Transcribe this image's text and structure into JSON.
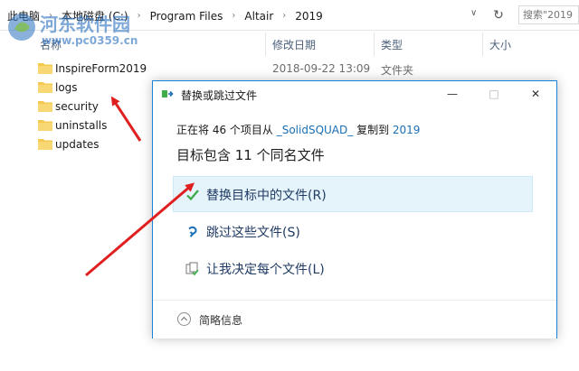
{
  "explorer": {
    "breadcrumbs": [
      "此电脑",
      "本地磁盘 (C:)",
      "Program Files",
      "Altair",
      "2019"
    ],
    "search_placeholder": "搜索\"2019",
    "columns": {
      "name": "名称",
      "modified": "修改日期",
      "type": "类型",
      "size": "大小"
    },
    "items": [
      {
        "name": "InspireForm2019",
        "modified": "2018-09-22 13:09",
        "type": "文件夹"
      },
      {
        "name": "logs",
        "modified": "",
        "type": ""
      },
      {
        "name": "security",
        "modified": "",
        "type": ""
      },
      {
        "name": "uninstalls",
        "modified": "",
        "type": ""
      },
      {
        "name": "updates",
        "modified": "",
        "type": ""
      }
    ]
  },
  "watermark": {
    "title": "河东软件园",
    "url": "www.pc0359.cn"
  },
  "dialog": {
    "title": "替换或跳过文件",
    "summary_prefix": "正在将 46 个项目从 ",
    "summary_source": "_SolidSQUAD_",
    "summary_middle": " 复制到 ",
    "summary_dest": "2019",
    "heading": "目标包含 11 个同名文件",
    "options": [
      {
        "label": "替换目标中的文件(R)",
        "icon": "check-icon",
        "selected": true
      },
      {
        "label": "跳过这些文件(S)",
        "icon": "skip-icon",
        "selected": false
      },
      {
        "label": "让我决定每个文件(L)",
        "icon": "decide-icon",
        "selected": false
      }
    ],
    "details_label": "简略信息"
  },
  "colors": {
    "accent": "#1883d7",
    "selected_bg": "#e5f3fb",
    "arrow": "#e02020",
    "folder": "#f4c94e",
    "watermark": "#2a6fbf"
  }
}
